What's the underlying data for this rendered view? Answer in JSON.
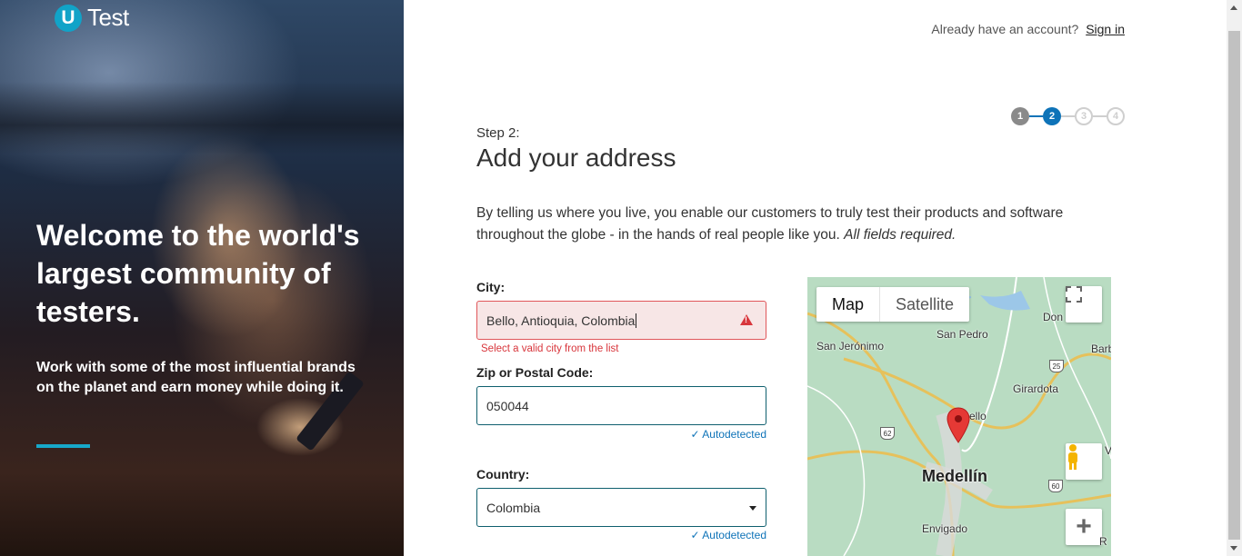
{
  "brand": {
    "logo_letter": "U",
    "logo_text": "Test"
  },
  "hero": {
    "title": "Welcome to the world's largest community of testers.",
    "subtitle": "Work with some of the most influential brands on the planet and earn money while doing it."
  },
  "header": {
    "prompt": "Already have an account?",
    "signin_label": "Sign in"
  },
  "stepper": {
    "steps": [
      "1",
      "2",
      "3",
      "4"
    ],
    "current": 2
  },
  "page": {
    "step_label": "Step 2:",
    "title": "Add your address",
    "intro": "By telling us where you live, you enable our customers to truly test their products and software throughout the globe - in the hands of real people like you.",
    "intro_emphasis": "All fields required."
  },
  "form": {
    "city": {
      "label": "City:",
      "value": "Bello, Antioquia, Colombia",
      "error": "Select a valid city from the list"
    },
    "zip": {
      "label": "Zip or Postal Code:",
      "value": "050044",
      "autodetected": "Autodetected"
    },
    "country": {
      "label": "Country:",
      "value": "Colombia",
      "autodetected": "Autodetected"
    }
  },
  "map": {
    "tabs": [
      "Map",
      "Satellite"
    ],
    "places": {
      "san_jeronimo": "San Jerónimo",
      "san_pedro": "San Pedro",
      "don": "Don",
      "barb": "Barb",
      "girardota": "Girardota",
      "bello": "Bello",
      "medellin": "Medellín",
      "envigado": "Envigado",
      "v": "V",
      "r": "R"
    },
    "shields": {
      "r25": "25",
      "r62": "62",
      "r60": "60"
    },
    "zoom_in": "+"
  },
  "colors": {
    "accent": "#0e73b8",
    "teal": "#17a8c9",
    "error": "#d8363c"
  }
}
